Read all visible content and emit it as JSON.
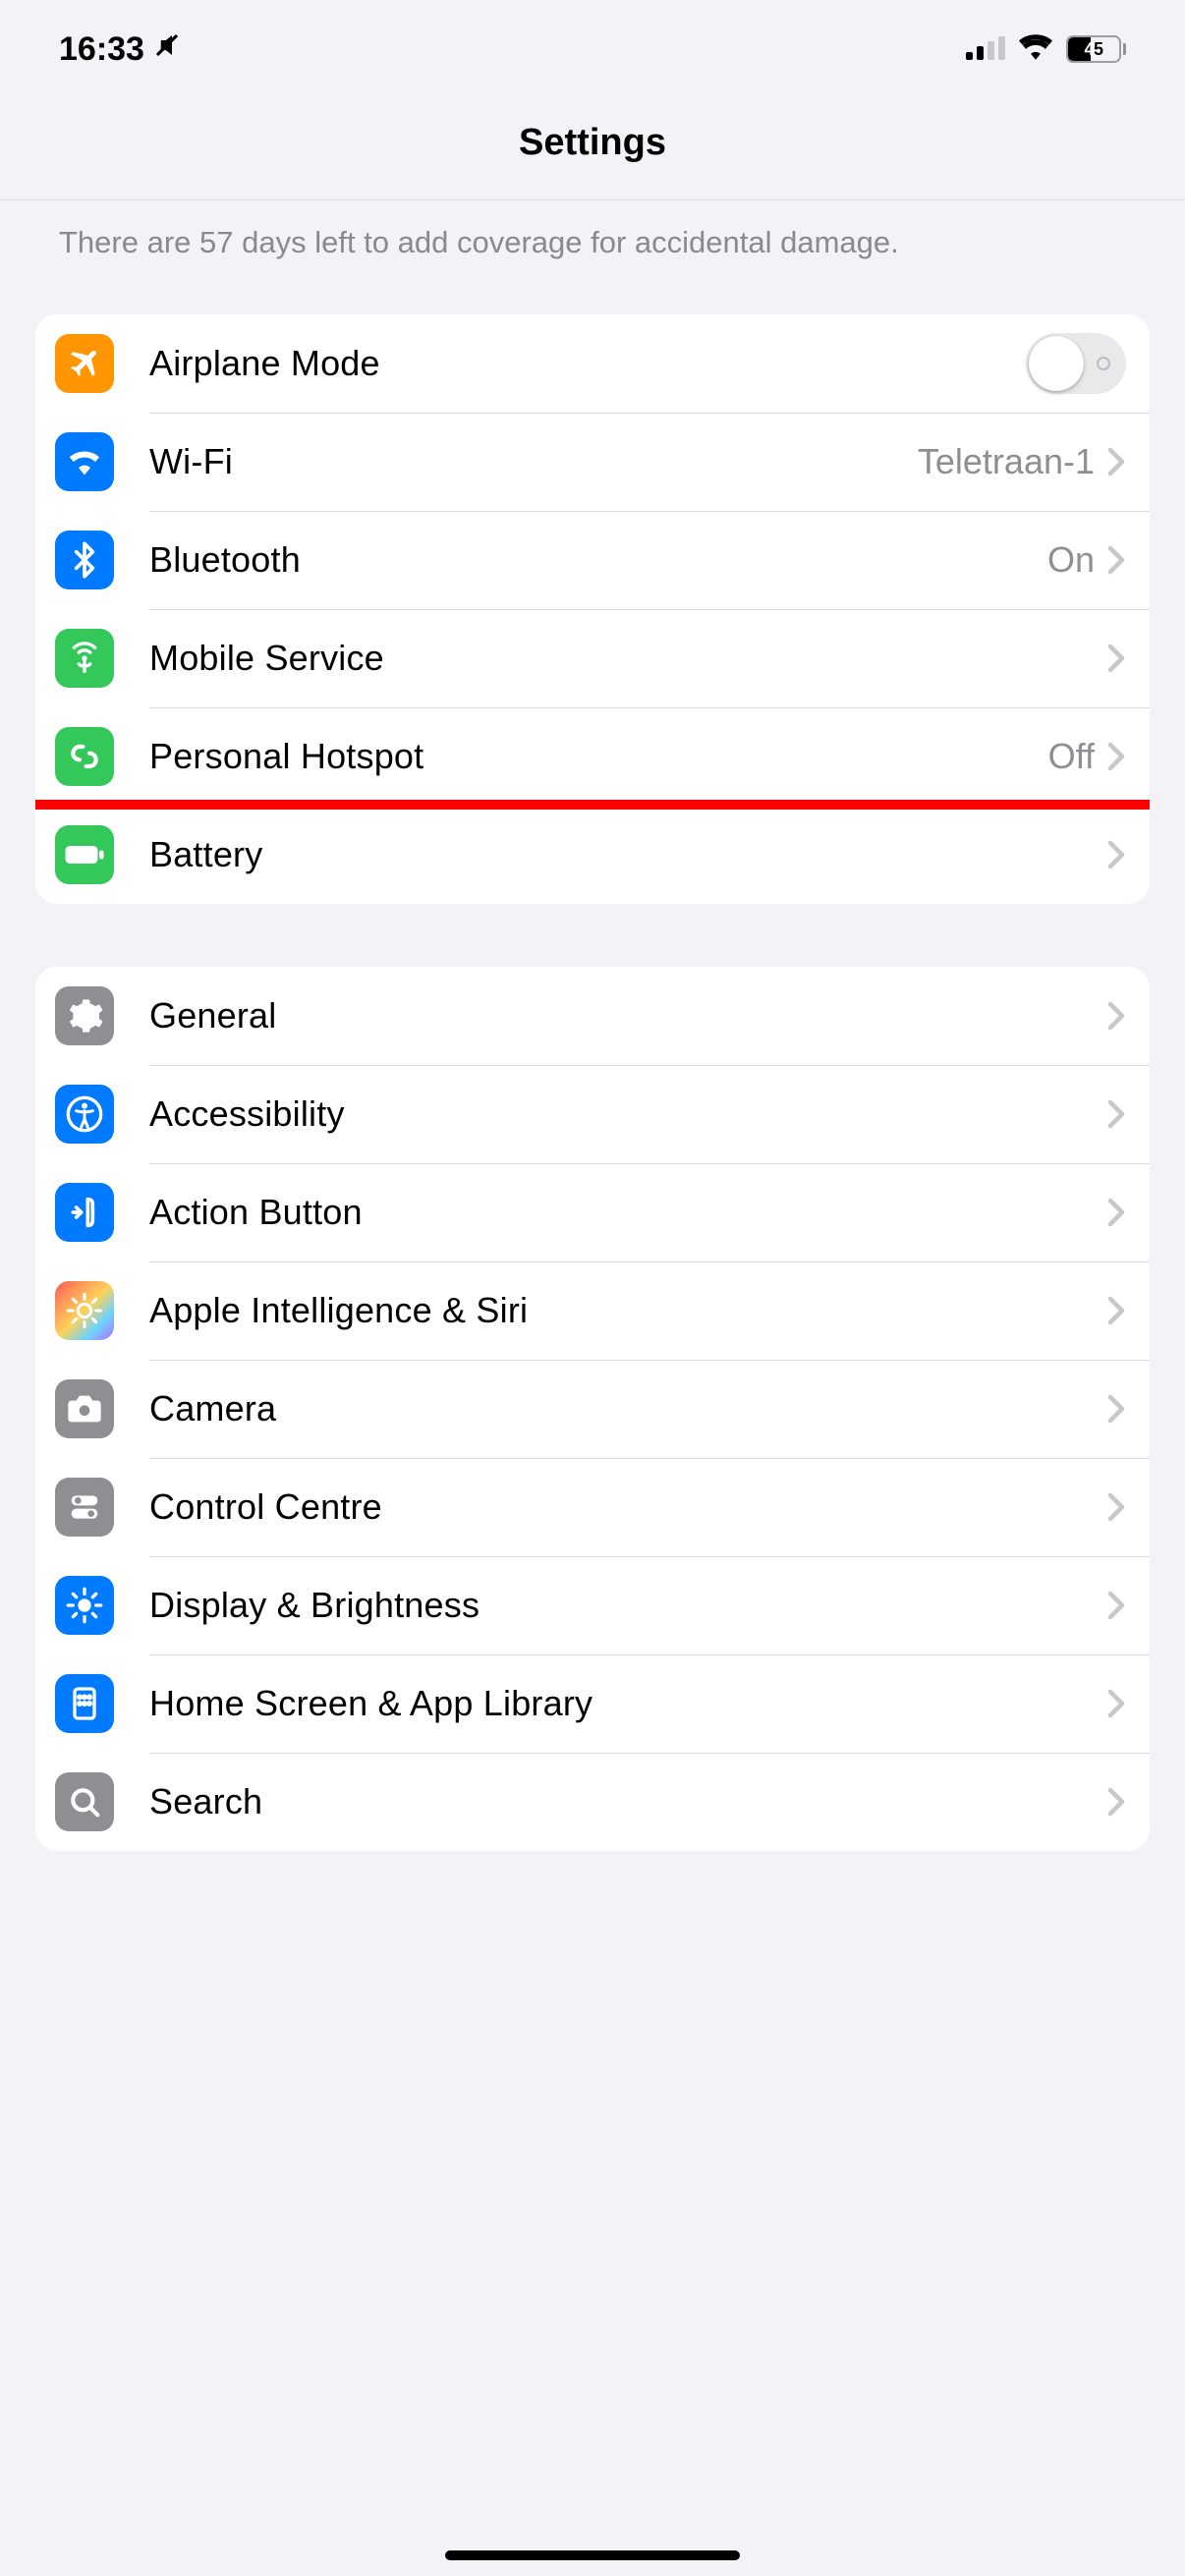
{
  "status": {
    "time": "16:33",
    "silent": true,
    "signal_bars": 2,
    "battery_percent": 45
  },
  "title": "Settings",
  "footer": "There are 57 days left to add coverage for accidental damage.",
  "groups": [
    {
      "rows": [
        {
          "id": "airplane",
          "label": "Airplane Mode",
          "type": "toggle",
          "toggled": false,
          "icon": "airplane-icon",
          "iconBg": "#ff9500"
        },
        {
          "id": "wifi",
          "label": "Wi-Fi",
          "value": "Teletraan-1",
          "type": "nav",
          "icon": "wifi-icon",
          "iconBg": "#007aff"
        },
        {
          "id": "bluetooth",
          "label": "Bluetooth",
          "value": "On",
          "type": "nav",
          "icon": "bluetooth-icon",
          "iconBg": "#007aff"
        },
        {
          "id": "mobile",
          "label": "Mobile Service",
          "type": "nav",
          "icon": "antenna-icon",
          "iconBg": "#34c759"
        },
        {
          "id": "hotspot",
          "label": "Personal Hotspot",
          "value": "Off",
          "type": "nav",
          "icon": "hotspot-icon",
          "iconBg": "#34c759"
        },
        {
          "id": "battery",
          "label": "Battery",
          "type": "nav",
          "icon": "battery-icon",
          "iconBg": "#34c759",
          "highlighted": true
        }
      ]
    },
    {
      "rows": [
        {
          "id": "general",
          "label": "General",
          "type": "nav",
          "icon": "gear-icon",
          "iconBg": "#8e8e93"
        },
        {
          "id": "accessibility",
          "label": "Accessibility",
          "type": "nav",
          "icon": "accessibility-icon",
          "iconBg": "#007aff"
        },
        {
          "id": "actionbutton",
          "label": "Action Button",
          "type": "nav",
          "icon": "action-button-icon",
          "iconBg": "#007aff"
        },
        {
          "id": "ai",
          "label": "Apple Intelligence & Siri",
          "type": "nav",
          "icon": "ai-icon",
          "iconBg": "gradient"
        },
        {
          "id": "camera",
          "label": "Camera",
          "type": "nav",
          "icon": "camera-icon",
          "iconBg": "#8e8e93"
        },
        {
          "id": "controlcentre",
          "label": "Control Centre",
          "type": "nav",
          "icon": "control-centre-icon",
          "iconBg": "#8e8e93"
        },
        {
          "id": "display",
          "label": "Display & Brightness",
          "type": "nav",
          "icon": "brightness-icon",
          "iconBg": "#007aff"
        },
        {
          "id": "homescreen",
          "label": "Home Screen & App Library",
          "type": "nav",
          "icon": "home-screen-icon",
          "iconBg": "#007aff"
        },
        {
          "id": "search",
          "label": "Search",
          "type": "nav",
          "icon": "search-icon",
          "iconBg": "#8e8e93"
        }
      ]
    }
  ]
}
